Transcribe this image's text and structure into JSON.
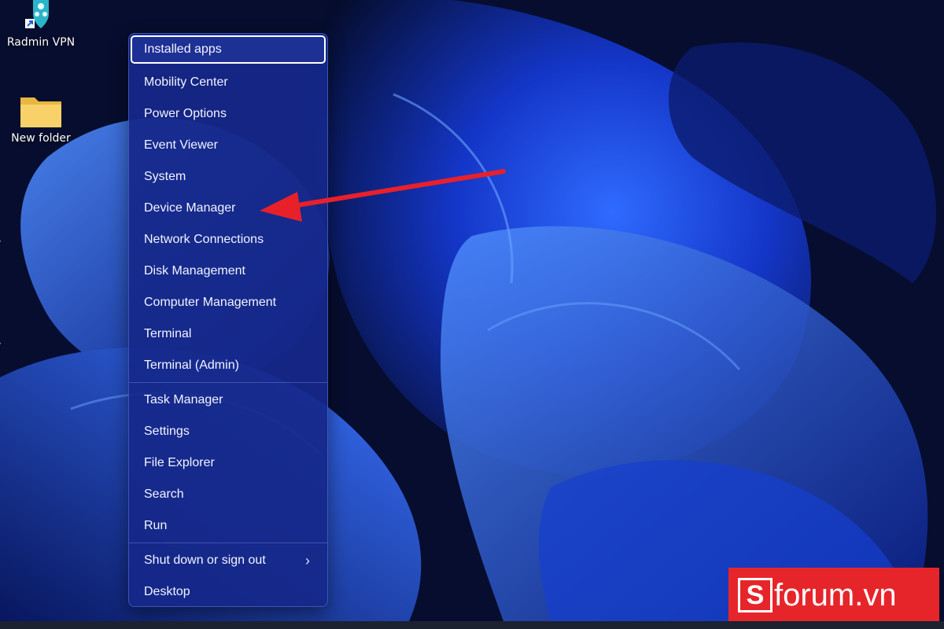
{
  "desktop": {
    "icons": [
      {
        "label": "Radmin VPN",
        "icon": "radmin-vpn-icon"
      },
      {
        "label": "New folder",
        "icon": "folder-icon"
      }
    ]
  },
  "winx_menu": {
    "focused_item": "Installed apps",
    "items": [
      {
        "label": "Installed apps"
      },
      {
        "label": "Mobility Center"
      },
      {
        "label": "Power Options"
      },
      {
        "label": "Event Viewer"
      },
      {
        "label": "System"
      },
      {
        "label": "Device Manager"
      },
      {
        "label": "Network Connections"
      },
      {
        "label": "Disk Management"
      },
      {
        "label": "Computer Management"
      },
      {
        "label": "Terminal"
      },
      {
        "label": "Terminal (Admin)"
      },
      {
        "label": "Task Manager"
      },
      {
        "label": "Settings"
      },
      {
        "label": "File Explorer"
      },
      {
        "label": "Search"
      },
      {
        "label": "Run"
      },
      {
        "label": "Shut down or sign out",
        "submenu_indicator": "›"
      },
      {
        "label": "Desktop"
      }
    ]
  },
  "annotation": {
    "type": "red-arrow",
    "points_to": "Device Manager",
    "color": "#e8202a"
  },
  "watermark": {
    "logo_letter": "S",
    "text": "forum.vn",
    "background": "#e6252b"
  },
  "colors": {
    "menu_bg": "#16288a",
    "wallpaper_accent": "#1e5bff"
  }
}
